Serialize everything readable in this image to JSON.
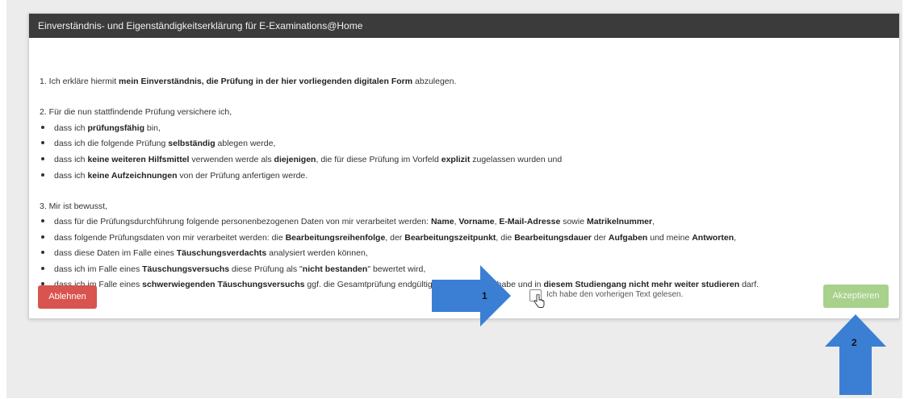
{
  "dialog": {
    "title": "Einverständnis- und Eigenständigkeitserklärung für E-Examinations@Home"
  },
  "section1": {
    "parts": [
      "1. Ich erkläre hiermit ",
      "mein Einverständnis, die Prüfung in der hier vorliegenden digitalen Form",
      " abzulegen."
    ]
  },
  "section2": {
    "heading": "2. Für die nun stattfindende Prüfung versichere ich,",
    "items": [
      [
        "dass ich ",
        "prüfungsfähig",
        " bin,"
      ],
      [
        "dass ich die folgende Prüfung ",
        "selbständig",
        " ablegen werde,"
      ],
      [
        "dass ich ",
        "keine weiteren Hilfsmittel",
        " verwenden werde als ",
        "diejenigen",
        ", die für diese Prüfung im Vorfeld ",
        "explizit",
        " zugelassen wurden und"
      ],
      [
        "dass ich ",
        "keine Aufzeichnungen",
        " von der Prüfung anfertigen werde."
      ]
    ]
  },
  "section3": {
    "heading": "3. Mir ist bewusst,",
    "items": [
      [
        "dass für die Prüfungsdurchführung folgende personenbezogenen Daten von mir verarbeitet werden: ",
        "Name",
        ", ",
        "Vorname",
        ", ",
        "E-Mail-Adresse",
        " sowie ",
        "Matrikelnummer",
        ","
      ],
      [
        "dass folgende Prüfungsdaten von mir verarbeitet werden: die ",
        "Bearbeitungsreihenfolge",
        ", der ",
        "Bearbeitungszeitpunkt",
        ", die ",
        "Bearbeitungsdauer",
        " der ",
        "Aufgaben",
        " und meine ",
        "Antworten",
        ","
      ],
      [
        "dass diese Daten im Falle eines ",
        "Täuschungsverdachts",
        " analysiert werden können,"
      ],
      [
        "dass ich im Falle eines ",
        "Täuschungsversuchs",
        " diese Prüfung als \"",
        "nicht bestanden",
        "\" bewertet wird,"
      ],
      [
        "dass ich im Falle eines ",
        "schwerwiegenden Täuschungsversuchs",
        " ggf. die Gesamtprüfung endgültig nicht bestanden habe und in ",
        "diesem Studiengang nicht mehr weiter studieren",
        " darf."
      ]
    ]
  },
  "actions": {
    "reject_label": "Ablehnen",
    "checkbox_label": "Ich habe den vorherigen Text gelesen.",
    "checkbox_checked": false,
    "accept_label": "Akzeptieren",
    "accept_enabled": false
  },
  "annotations": {
    "arrow1_number": "1",
    "arrow2_number": "2",
    "arrow_color": "#3b7fd4"
  },
  "colors": {
    "header_bg": "#3b3b3b",
    "reject": "#d9534f",
    "accept_disabled": "#a8d18c"
  }
}
